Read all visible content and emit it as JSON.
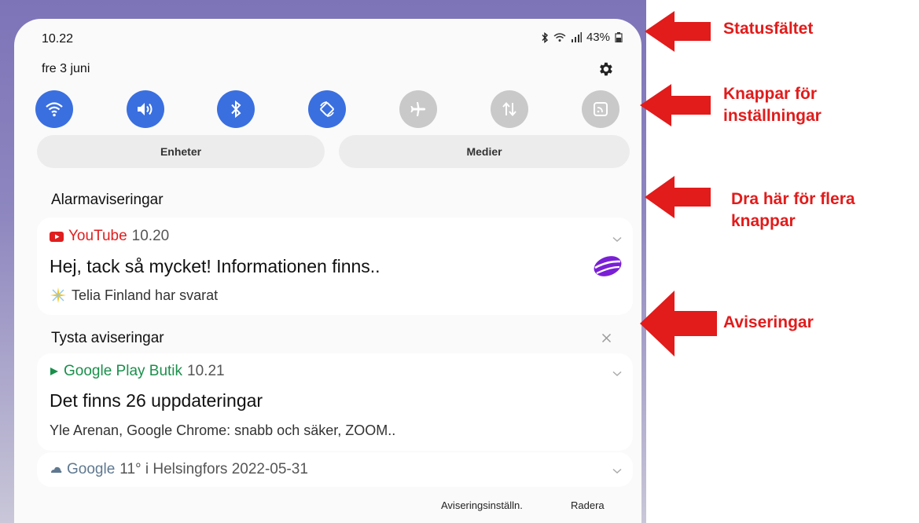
{
  "status_bar": {
    "time": "10.22",
    "battery": "43%"
  },
  "date": "fre 3 juni",
  "quick_settings": [
    {
      "name": "wifi",
      "active": true
    },
    {
      "name": "sound",
      "active": true
    },
    {
      "name": "bluetooth",
      "active": true
    },
    {
      "name": "auto-rotate",
      "active": true
    },
    {
      "name": "airplane-mode",
      "active": false
    },
    {
      "name": "mobile-data",
      "active": false
    },
    {
      "name": "nfc",
      "active": false
    }
  ],
  "devices_label": "Enheter",
  "media_label": "Medier",
  "alarm_section": {
    "title": "Alarmaviseringar",
    "notification": {
      "app": "YouTube",
      "time": "10.20",
      "title": "Hej, tack så mycket! Informationen finns..",
      "text": "Telia Finland har svarat"
    }
  },
  "silent_section": {
    "title": "Tysta aviseringar",
    "notifications": [
      {
        "app": "Google Play Butik",
        "time": "10.21",
        "title": "Det finns 26 uppdateringar",
        "text": "Yle Arenan, Google Chrome: snabb och säker, ZOOM.."
      },
      {
        "app": "Google",
        "summary": "11° i Helsingfors 2022-05-31"
      }
    ]
  },
  "footer": {
    "settings": "Aviseringsinställn.",
    "clear": "Radera"
  },
  "callouts": {
    "status": "Statusfältet",
    "buttons_line1": "Knappar för",
    "buttons_line2": "inställningar",
    "drag_line1": "Dra här för flera",
    "drag_line2": "knappar",
    "notifications": "Aviseringar"
  },
  "colors": {
    "accent": "#3a6fe0",
    "youtube": "#e01e1e",
    "google_play": "#1a8f4b",
    "google": "#5f7890",
    "callout": "#e21b1b"
  }
}
